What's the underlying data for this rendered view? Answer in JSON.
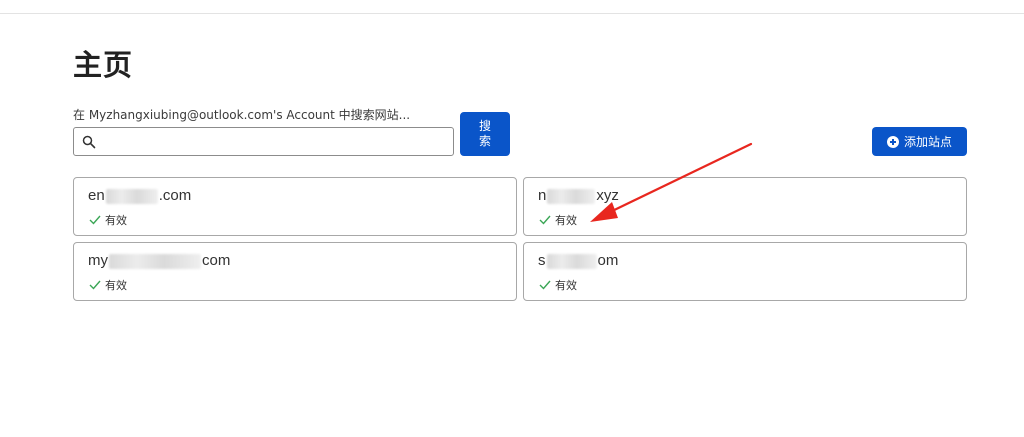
{
  "page": {
    "title": "主页"
  },
  "search": {
    "label": "在 Myzhangxiubing@outlook.com's Account 中搜索网站...",
    "value": "",
    "placeholder": "",
    "button_label": "搜索",
    "icon": "search-icon"
  },
  "toolbar": {
    "add_site_label": "添加站点",
    "add_site_icon": "plus-circle-icon",
    "accent_color": "#0a55c9"
  },
  "sites": [
    {
      "prefix": "en",
      "suffix": ".com",
      "status": "有效"
    },
    {
      "prefix": "n",
      "suffix": "xyz",
      "status": "有效"
    },
    {
      "prefix": "my",
      "suffix": "com",
      "status": "有效"
    },
    {
      "prefix": "s",
      "suffix": "om",
      "status": "有效"
    }
  ],
  "status_color": "#3aa655",
  "annotation": {
    "type": "red-arrow",
    "color": "#e8271f"
  }
}
